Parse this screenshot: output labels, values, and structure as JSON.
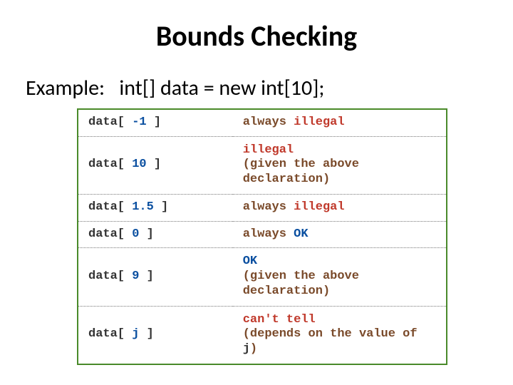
{
  "slide": {
    "title": "Bounds Checking",
    "example_label": "Example:",
    "example_code": "int[] data = new int[10];"
  },
  "table": {
    "rows": [
      {
        "lhs": {
          "before": "data[ ",
          "index": "-1",
          "after": " ]"
        },
        "rhs": [
          {
            "text": "always ",
            "cls": "word-brown"
          },
          {
            "text": "illegal",
            "cls": "word-red"
          }
        ]
      },
      {
        "lhs": {
          "before": "data[ ",
          "index": "10",
          "after": " ]"
        },
        "rhs": [
          {
            "text": "illegal",
            "cls": "word-red"
          },
          {
            "text": "\n",
            "cls": ""
          },
          {
            "text": "(",
            "cls": "word-brown"
          },
          {
            "text": "given the above declaration",
            "cls": "word-brown"
          },
          {
            "text": ")",
            "cls": "word-brown"
          }
        ]
      },
      {
        "lhs": {
          "before": "data[ ",
          "index": "1.5",
          "after": " ]"
        },
        "rhs": [
          {
            "text": "always ",
            "cls": "word-brown"
          },
          {
            "text": "illegal",
            "cls": "word-red"
          }
        ]
      },
      {
        "lhs": {
          "before": "data[ ",
          "index": "0",
          "after": " ]"
        },
        "rhs": [
          {
            "text": "always ",
            "cls": "word-brown"
          },
          {
            "text": "OK",
            "cls": "word-blue"
          }
        ]
      },
      {
        "lhs": {
          "before": "data[ ",
          "index": "9",
          "after": " ]"
        },
        "rhs": [
          {
            "text": "OK",
            "cls": "word-blue"
          },
          {
            "text": "\n",
            "cls": ""
          },
          {
            "text": "(",
            "cls": "word-brown"
          },
          {
            "text": "given the above declaration",
            "cls": "word-brown"
          },
          {
            "text": ")",
            "cls": "word-brown"
          }
        ]
      },
      {
        "lhs": {
          "before": "data[ ",
          "index": "j",
          "after": " ]"
        },
        "rhs": [
          {
            "text": "can't tell",
            "cls": "word-red"
          },
          {
            "text": "\n",
            "cls": ""
          },
          {
            "text": "(",
            "cls": "word-brown"
          },
          {
            "text": "depends on the value of ",
            "cls": "word-brown"
          },
          {
            "text": "j",
            "cls": "word-dark"
          },
          {
            "text": ")",
            "cls": "word-brown"
          }
        ]
      }
    ]
  }
}
